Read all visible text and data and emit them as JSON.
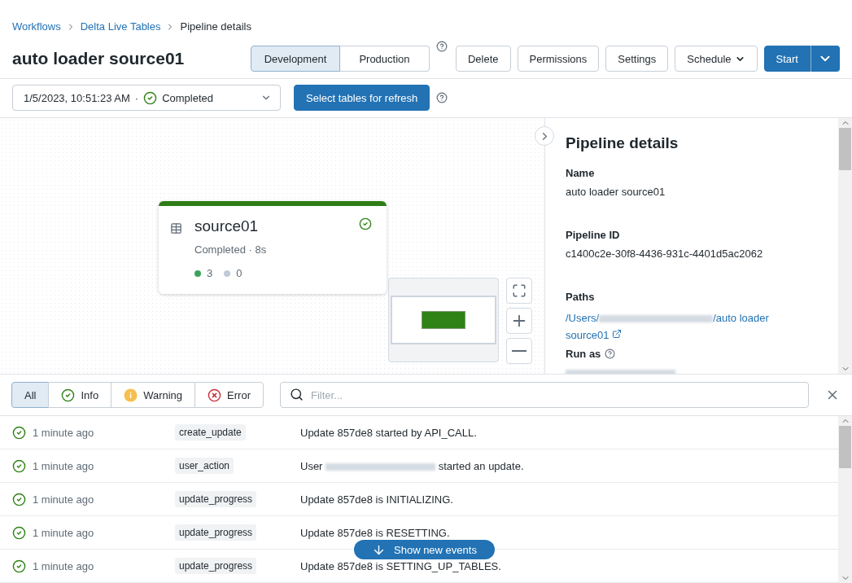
{
  "breadcrumbs": [
    {
      "label": "Workflows",
      "link": true
    },
    {
      "label": "Delta Live Tables",
      "link": true
    },
    {
      "label": "Pipeline details",
      "link": false
    }
  ],
  "title": "auto loader source01",
  "mode_toggle": [
    {
      "label": "Development",
      "selected": true
    },
    {
      "label": "Production",
      "selected": false
    }
  ],
  "actions": [
    {
      "label": "Delete",
      "kind": "plain"
    },
    {
      "label": "Permissions",
      "kind": "plain"
    },
    {
      "label": "Settings",
      "kind": "plain"
    },
    {
      "label": "Schedule",
      "kind": "dropdown"
    }
  ],
  "start_button": {
    "label": "Start"
  },
  "run_select": {
    "timestamp": "1/5/2023, 10:51:23 AM",
    "separator": "·",
    "status": "Completed"
  },
  "refresh_button": {
    "label": "Select tables for refresh"
  },
  "graph": {
    "nodes": [
      {
        "name": "source01",
        "kind": "table",
        "completed": true,
        "status": "Completed · 8s",
        "counts": [
          {
            "value": "3",
            "color": "#3ca55c"
          },
          {
            "value": "0",
            "color": "#c2cbd8"
          }
        ]
      }
    ]
  },
  "details": {
    "title": "Pipeline details",
    "fields": [
      {
        "label": "Name",
        "value": "auto loader source01"
      },
      {
        "label": "Pipeline ID",
        "value": "c1400c2e-30f8-4436-931c-4401d5ac2062"
      }
    ],
    "paths": {
      "label": "Paths",
      "prefix": "/Users/",
      "suffix": "/auto loader source01"
    },
    "run_as": {
      "label": "Run as"
    }
  },
  "filters": [
    {
      "label": "All",
      "kind": "all",
      "selected": true
    },
    {
      "label": "Info",
      "kind": "info",
      "selected": false
    },
    {
      "label": "Warning",
      "kind": "warning",
      "selected": false
    },
    {
      "label": "Error",
      "kind": "error",
      "selected": false
    }
  ],
  "search": {
    "placeholder": "Filter..."
  },
  "events": [
    {
      "kind": "info",
      "time": "1 minute ago",
      "type": "create_update",
      "message": "Update 857de8 started by API_CALL."
    },
    {
      "kind": "info",
      "time": "1 minute ago",
      "type": "user_action",
      "message": "User",
      "message_end": "started an update."
    },
    {
      "kind": "info",
      "time": "1 minute ago",
      "type": "update_progress",
      "message": "Update 857de8 is INITIALIZING."
    },
    {
      "kind": "info",
      "time": "1 minute ago",
      "type": "update_progress",
      "message": "Update 857de8 is RESETTING."
    },
    {
      "kind": "info",
      "time": "1 minute ago",
      "type": "update_progress",
      "message": "Update 857de8 is SETTING_UP_TABLES."
    }
  ],
  "show_new_events": {
    "label": "Show new events"
  }
}
